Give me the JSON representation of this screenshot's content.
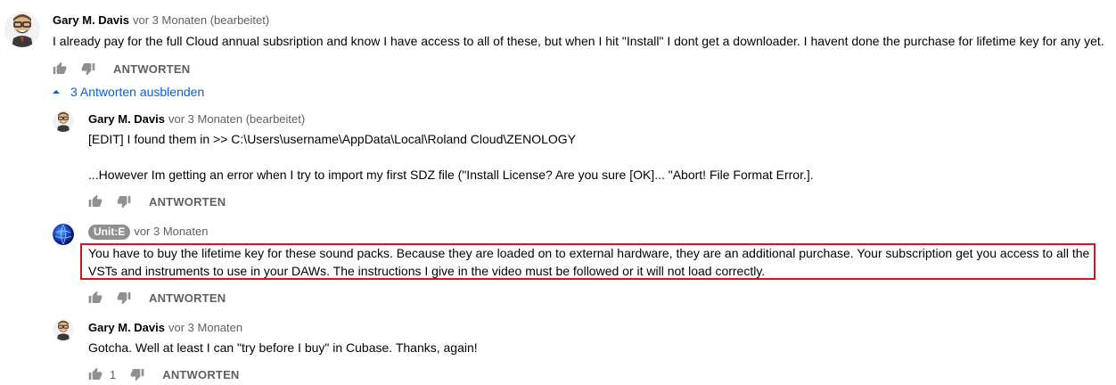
{
  "comment": {
    "author": "Gary M. Davis",
    "time": "vor 3 Monaten (bearbeitet)",
    "text": "I already pay for the full Cloud annual subsription and know I have access to all of these, but when I hit \"Install\" I dont get a downloader.  I havent done the purchase for lifetime key for any yet.",
    "reply_label": "ANTWORTEN"
  },
  "toggle": {
    "label": "3 Antworten ausblenden"
  },
  "replies": [
    {
      "author": "Gary M. Davis",
      "time": "vor 3 Monaten (bearbeitet)",
      "line1": "[EDIT] I found them in >> C:\\Users\\username\\AppData\\Local\\Roland Cloud\\ZENOLOGY",
      "line2": "...However Im getting an error when I try to import my first SDZ file (\"Install License? Are you sure [OK]... \"Abort! File Format Error.].",
      "reply_label": "ANTWORTEN"
    },
    {
      "author": "Unit:E",
      "time": "vor 3 Monaten",
      "line1": "You have to buy the lifetime key for these sound packs. Because they are loaded on to external hardware, they are an additional purchase. Your subscription get you access to all the",
      "line2": "VSTs and instruments to use in your DAWs.  The instructions I give in the video must be followed or it will not load correctly.",
      "reply_label": "ANTWORTEN"
    },
    {
      "author": "Gary M. Davis",
      "time": "vor 3 Monaten",
      "line1": "Gotcha.  Well at least I can \"try before I buy\" in Cubase.  Thanks, again!",
      "like_count": "1",
      "reply_label": "ANTWORTEN"
    }
  ],
  "colors": {
    "highlight": "#d9131b",
    "link": "#065fd4",
    "meta": "#606060",
    "badge": "#909090"
  },
  "icons": [
    "thumb-up-icon",
    "thumb-down-icon",
    "caret-up-icon",
    "caricature-avatar",
    "globe-avatar"
  ]
}
